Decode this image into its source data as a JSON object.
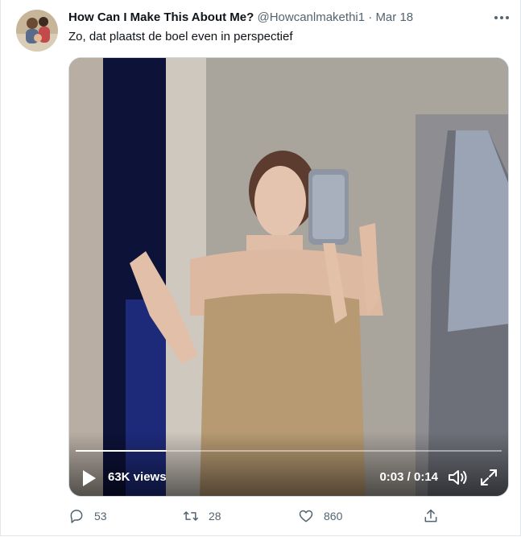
{
  "tweet": {
    "author_name": "How Can I Make This About Me?",
    "handle": "@Howcanlmakethi1",
    "separator": "·",
    "date": "Mar 18",
    "text": "Zo, dat plaatst de boel even in perspectief"
  },
  "video": {
    "views": "63K views",
    "time": "0:03 / 0:14",
    "progress": 0.214
  },
  "actions": {
    "replies": "53",
    "retweets": "28",
    "likes": "860"
  },
  "icons": {
    "more": "more-horizontal-icon",
    "play": "play-icon",
    "volume": "volume-icon",
    "fullscreen": "fullscreen-icon",
    "reply": "reply-icon",
    "retweet": "retweet-icon",
    "like": "heart-icon",
    "share": "share-icon"
  },
  "colors": {
    "secondary_text": "#536471",
    "border": "#cfd9de"
  }
}
